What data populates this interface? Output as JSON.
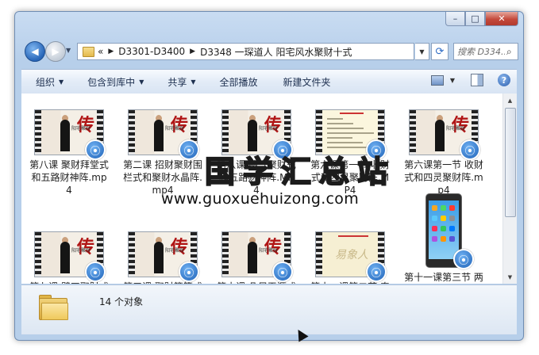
{
  "window": {
    "buttons": {
      "minimize": "–",
      "maximize": "□",
      "close": "✕"
    }
  },
  "nav": {
    "address": {
      "prefix": "«",
      "crumbs": [
        "D3301-D3400",
        "D3348 一琛道人 阳宅风水聚财十式"
      ]
    },
    "search_placeholder": "搜索 D334..."
  },
  "toolbar": {
    "organize": "组织",
    "include_in_library": "包含到库中",
    "share": "共享",
    "play_all": "全部播放",
    "new_folder": "新建文件夹"
  },
  "files": [
    {
      "name": "第八课 聚财拜堂式和五路财神阵.mp4",
      "thumb": "red"
    },
    {
      "name": "第二课 招财聚财围栏式和聚财水晶阵.mp4",
      "thumb": "red"
    },
    {
      "name": "第八课 纳气聚财式和五路财神阵.MP4",
      "thumb": "red"
    },
    {
      "name": "第六课第一节 收财式和四灵聚财阵.MP4",
      "thumb": "text"
    },
    {
      "name": "第六课第一节 收财式和四灵聚财阵.mp4",
      "thumb": "red"
    },
    {
      "name": "第七课 壁刀聚财式和五星聚财阵",
      "thumb": "red"
    },
    {
      "name": "第三课 聚财簸箕式（一年进出）",
      "thumb": "red"
    },
    {
      "name": "第十课 几尺天涯式和五行聚财式",
      "thumb": "red"
    },
    {
      "name": "第十一课第二节 奇门遁甲二套催",
      "thumb": "yellow"
    },
    {
      "name": "第十一课第三节 两套催财法、找",
      "thumb": "phone"
    }
  ],
  "status": {
    "count": "14 个对象"
  },
  "watermark": {
    "cn": "国学汇总站",
    "url": "www.guoxuehuizong.com"
  },
  "thumb_text": {
    "red_glyph": "传",
    "red_caption": "阳宅聚财",
    "yellow_scrib": "易象人"
  }
}
